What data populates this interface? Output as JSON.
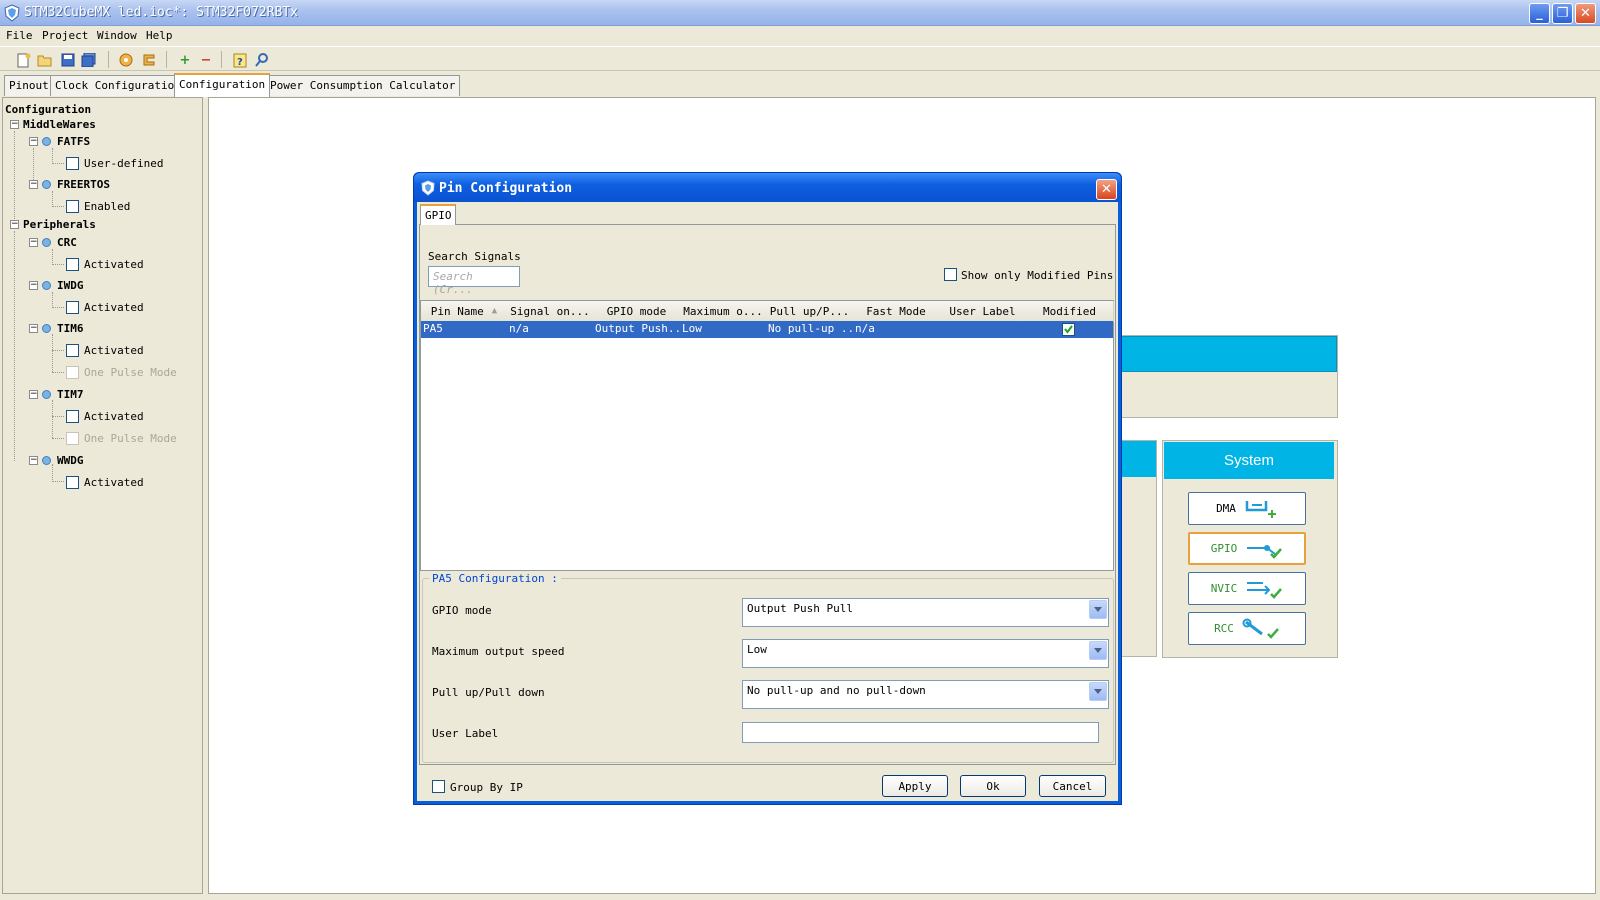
{
  "window": {
    "title": "STM32CubeMX led.ioc*: STM32F072RBTx",
    "controls": [
      "_",
      "❐",
      "✕"
    ]
  },
  "menu": [
    "File",
    "Project",
    "Window",
    "Help"
  ],
  "toolbar_icons": [
    "new-project-icon",
    "open-icon",
    "save-icon",
    "save-all-icon",
    "generate-report-icon",
    "generate-code-icon",
    "add-icon",
    "remove-icon",
    "help-icon",
    "search-icon"
  ],
  "main_tabs": [
    {
      "label": "Pinout",
      "active": false
    },
    {
      "label": "Clock Configuration",
      "active": false
    },
    {
      "label": "Configuration",
      "active": true
    },
    {
      "label": "Power Consumption Calculator",
      "active": false
    }
  ],
  "tree": {
    "root": "Configuration",
    "middlewares": {
      "label": "MiddleWares",
      "items": [
        {
          "name": "FATFS",
          "options": [
            "User-defined"
          ]
        },
        {
          "name": "FREERTOS",
          "options": [
            "Enabled"
          ]
        }
      ]
    },
    "peripherals": {
      "label": "Peripherals",
      "items": [
        {
          "name": "CRC",
          "options": [
            "Activated"
          ]
        },
        {
          "name": "IWDG",
          "options": [
            "Activated"
          ]
        },
        {
          "name": "TIM6",
          "options": [
            "Activated",
            "One Pulse Mode"
          ]
        },
        {
          "name": "TIM7",
          "options": [
            "Activated",
            "One Pulse Mode"
          ]
        },
        {
          "name": "WWDG",
          "options": [
            "Activated"
          ]
        }
      ]
    }
  },
  "system_panel": {
    "title": "System",
    "buttons": [
      "DMA",
      "GPIO",
      "NVIC",
      "RCC"
    ]
  },
  "dialog": {
    "title": "Pin Configuration",
    "tab": "GPIO",
    "search_label": "Search Signals",
    "search_placeholder": "Search (Cr...",
    "show_modified_label": "Show only Modified Pins",
    "columns": [
      "Pin Name",
      "Signal on...",
      "GPIO mode",
      "Maximum o...",
      "Pull up/P...",
      "Fast Mode",
      "User Label",
      "Modified"
    ],
    "rows": [
      {
        "pin": "PA5",
        "signal": "n/a",
        "mode": "Output Push...",
        "speed": "Low",
        "pull": "No pull-up ...",
        "fast": "n/a",
        "user_label": "",
        "modified": true
      }
    ],
    "config": {
      "title": "PA5 Configuration :",
      "fields": [
        {
          "label": "GPIO mode",
          "value": "Output Push Pull"
        },
        {
          "label": "Maximum output speed",
          "value": "Low"
        },
        {
          "label": "Pull up/Pull down",
          "value": "No pull-up and no pull-down"
        },
        {
          "label": "User Label",
          "value": ""
        }
      ]
    },
    "group_by_ip_label": "Group By IP",
    "buttons": {
      "apply": "Apply",
      "ok": "Ok",
      "cancel": "Cancel"
    }
  },
  "colors": {
    "selection": "#316ac5",
    "category_header": "#00b4e6",
    "accent_tab": "#e6a23c",
    "dialog_title": "#0a52d0"
  }
}
